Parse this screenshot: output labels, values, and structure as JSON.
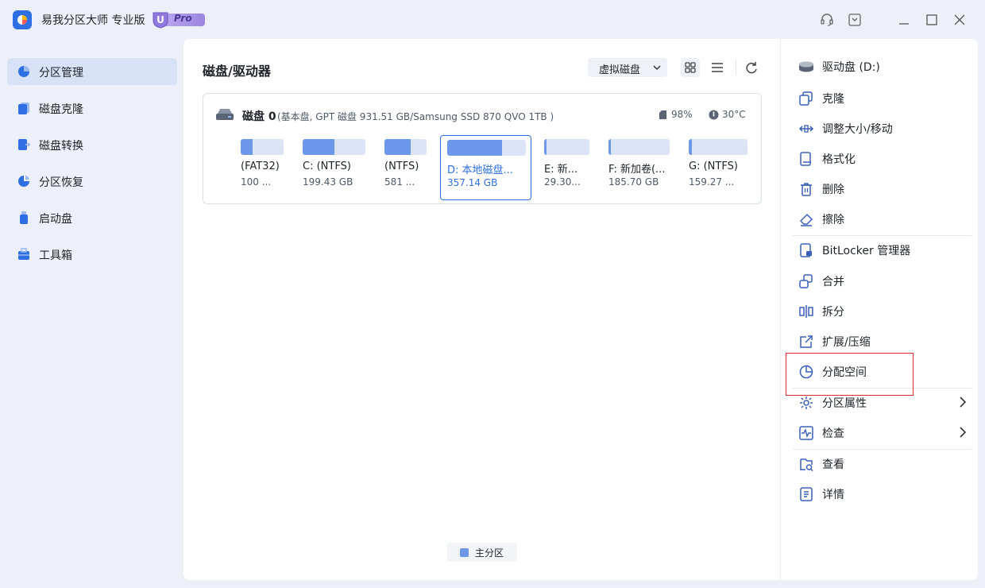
{
  "app": {
    "title": "易我分区大师 专业版",
    "badge_letter": "U",
    "badge_text": "Pro"
  },
  "sidebar": {
    "items": [
      {
        "label": "分区管理",
        "icon": "pie-chart-icon",
        "active": true
      },
      {
        "label": "磁盘克隆",
        "icon": "disk-clone-icon",
        "active": false
      },
      {
        "label": "磁盘转换",
        "icon": "disk-convert-icon",
        "active": false
      },
      {
        "label": "分区恢复",
        "icon": "partition-recovery-icon",
        "active": false
      },
      {
        "label": "启动盘",
        "icon": "boot-disk-icon",
        "active": false
      },
      {
        "label": "工具箱",
        "icon": "toolbox-icon",
        "active": false
      }
    ]
  },
  "main": {
    "title": "磁盘/驱动器",
    "virtual_disk_label": "虚拟磁盘",
    "disk": {
      "name": "磁盘 0",
      "description": "(基本盘, GPT 磁盘 931.51 GB/Samsung SSD 870 QVO 1TB )",
      "health": "98%",
      "temperature": "30°C",
      "partitions": [
        {
          "name": "(FAT32)",
          "size": "100 ...",
          "used_fraction": 0.28,
          "selected": false
        },
        {
          "name": "C: (NTFS)",
          "size": "199.43 GB",
          "used_fraction": 0.5,
          "selected": false
        },
        {
          "name": "(NTFS)",
          "size": "581 ...",
          "used_fraction": 0.62,
          "selected": false
        },
        {
          "name": "D: 本地磁盘...",
          "size": "357.14 GB",
          "used_fraction": 0.7,
          "selected": true
        },
        {
          "name": "E: 新...",
          "size": "29.30...",
          "used_fraction": 0.05,
          "selected": false
        },
        {
          "name": "F: 新加卷(...",
          "size": "185.70 GB",
          "used_fraction": 0.04,
          "selected": false
        },
        {
          "name": "G: (NTFS)",
          "size": "159.27 ...",
          "used_fraction": 0.05,
          "selected": false
        }
      ]
    },
    "legend": {
      "label": "主分区",
      "color": "#6d97e8"
    }
  },
  "actions": {
    "drive": "驱动盘 (D:)",
    "items": [
      {
        "label": "克隆",
        "icon": "clone-icon"
      },
      {
        "label": "调整大小/移动",
        "icon": "resize-move-icon"
      },
      {
        "label": "格式化",
        "icon": "format-icon"
      },
      {
        "label": "删除",
        "icon": "trash-icon"
      },
      {
        "label": "擦除",
        "icon": "eraser-icon"
      },
      {
        "label": "BitLocker 管理器",
        "icon": "bitlocker-icon"
      },
      {
        "label": "合并",
        "icon": "merge-icon"
      },
      {
        "label": "拆分",
        "icon": "split-icon"
      },
      {
        "label": "扩展/压缩",
        "icon": "extend-shrink-icon"
      },
      {
        "label": "分配空间",
        "icon": "allocate-space-icon"
      },
      {
        "label": "分区属性",
        "icon": "partition-properties-icon"
      },
      {
        "label": "检查",
        "icon": "check-icon"
      },
      {
        "label": "查看",
        "icon": "view-icon"
      },
      {
        "label": "详情",
        "icon": "details-icon"
      }
    ]
  },
  "colors": {
    "accent": "#2f6fe4",
    "partition_fill": "#6d97e8",
    "highlight": "#e02b2b"
  }
}
